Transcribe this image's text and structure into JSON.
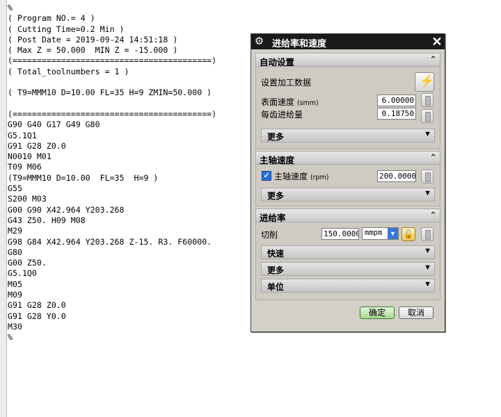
{
  "code_lines": [
    "%",
    "( Program NO.= 4 )",
    "( Cutting Time=0.2 Min )",
    "( Post Date = 2019-09-24 14:51:18 )",
    "( Max Z = 50.000  MIN Z = -15.000 )",
    "(=========================================)",
    "( Total_toolnumbers = 1 )",
    "",
    "( T9=MMM10 D=10.00 FL=35 H=9 ZMIN=50.000 )",
    "",
    "(=========================================)",
    "G90 G40 G17 G49 G80",
    "G5.1Q1",
    "G91 G28 Z0.0",
    "N0010 M01",
    "T09 M06",
    "(T9=MMM10 D=10.00  FL=35  H=9 )",
    "G55",
    "S200 M03",
    "G00 G90 X42.964 Y203.268",
    "G43 Z50. H09 M08",
    "M29",
    "G98 G84 X42.964 Y203.268 Z-15. R3. F60000.",
    "G80",
    "G00 Z50.",
    "G5.1Q0",
    "M05",
    "M09",
    "G91 G28 Z0.0",
    "G91 G28 Y0.0",
    "M30",
    "%"
  ],
  "dialog": {
    "title": "进给率和速度",
    "auto_section": {
      "header": "自动设置",
      "set_machining_data": "设置加工数据",
      "surface_speed_label": "表面速度",
      "surface_speed_unit": "(smm)",
      "surface_speed_value": "6.00000",
      "feed_per_tooth_label": "每齿进给量",
      "feed_per_tooth_value": "0.18750",
      "more": "更多"
    },
    "spindle_section": {
      "header": "主轴速度",
      "spindle_label": "主轴速度",
      "spindle_unit": "(rpm)",
      "spindle_value": "200.00000",
      "spindle_checked": true,
      "more": "更多"
    },
    "feed_section": {
      "header": "进给率",
      "cut_label": "切削",
      "cut_value": "150.00000",
      "cut_unit": "mmpm",
      "rapid": "快速",
      "more": "更多",
      "units": "单位"
    },
    "ok_button": "确定",
    "cancel_button": "取消"
  }
}
